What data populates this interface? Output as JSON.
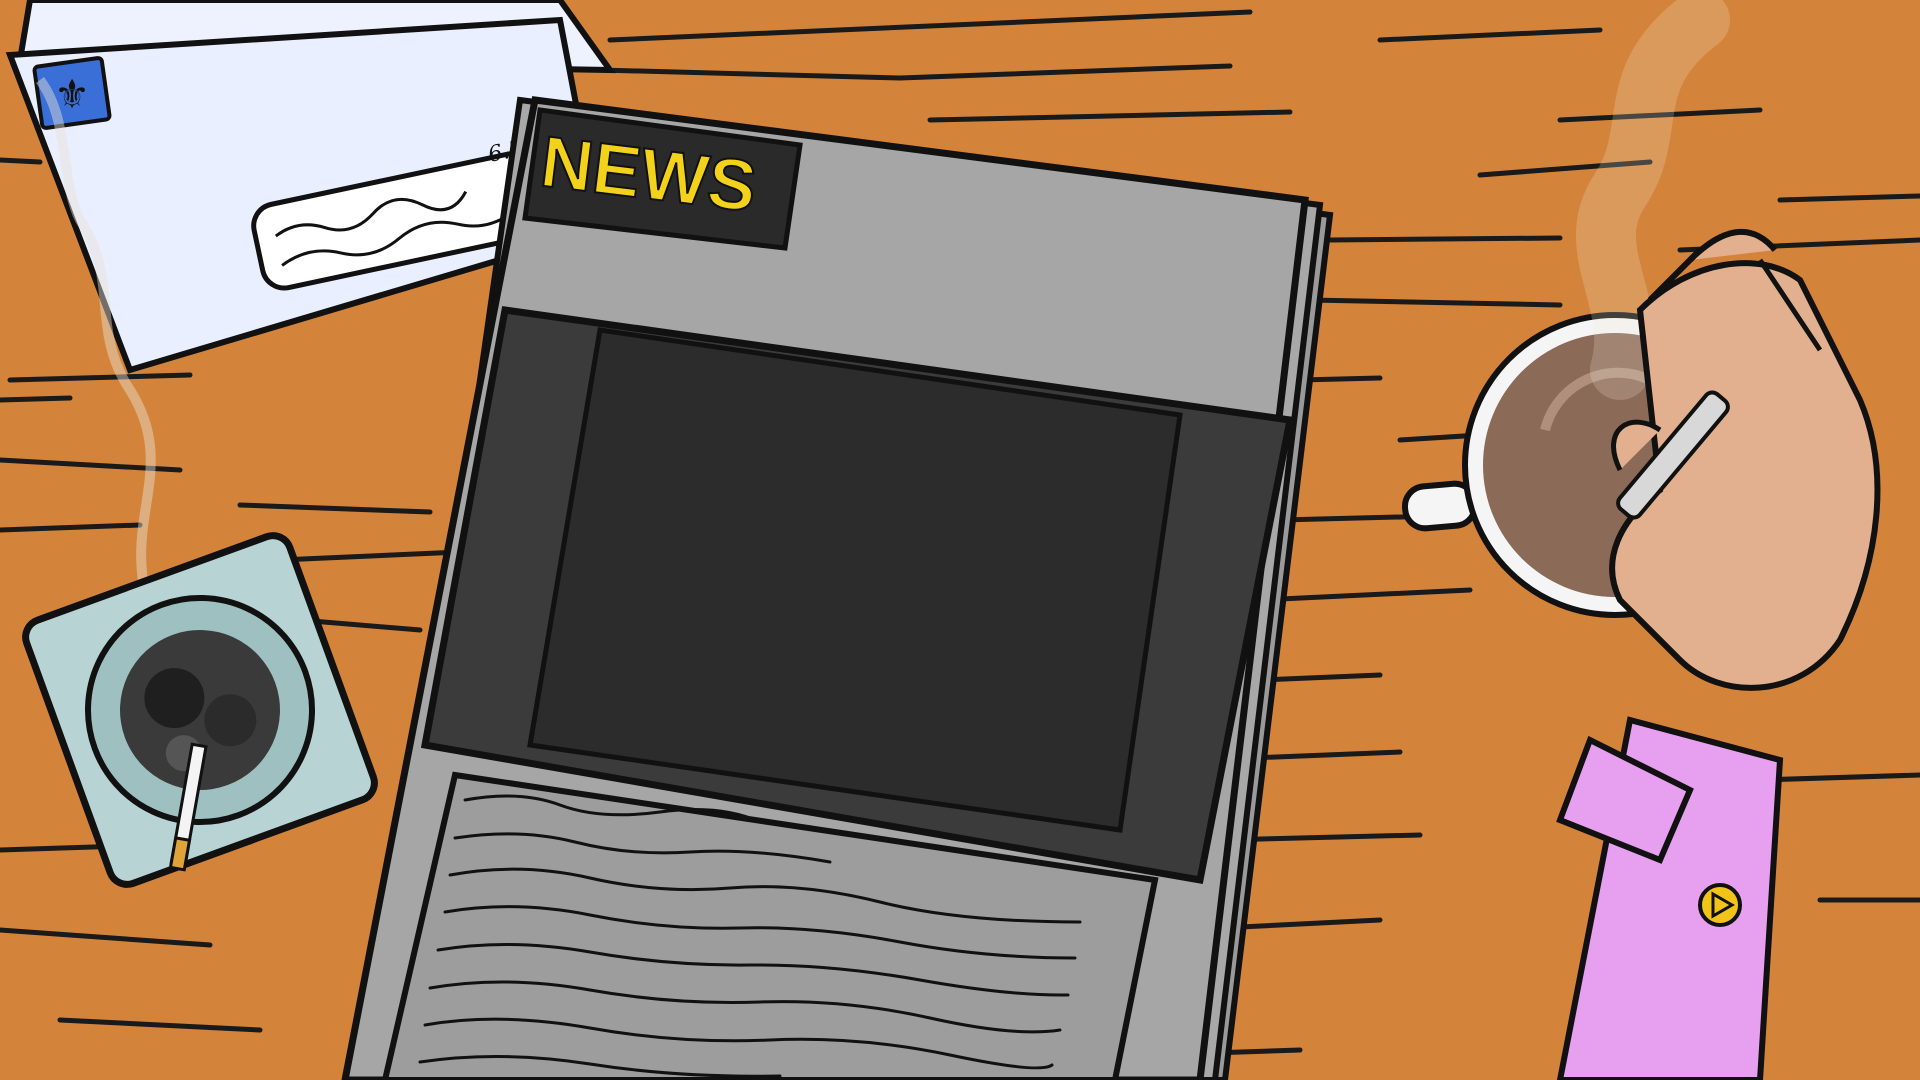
{
  "scene": {
    "description_free": true,
    "colors": {
      "desk": "#d4843a",
      "desk_grain": "#1a1a1a",
      "paper_light": "#a9a9a9",
      "paper_dark": "#3a3a3a",
      "news_yellow": "#f2d21b",
      "envelope": "#e9efff",
      "stamp": "#3b6fd8",
      "coffee": "#8b6a57",
      "skin": "#e2b08e",
      "sleeve": "#e6a0ef",
      "cufflink": "#f2c419",
      "ashtray": "#b7d3d3"
    }
  },
  "newspaper": {
    "masthead": "NEWS"
  },
  "envelope": {
    "date": "6.7.3"
  },
  "icons": {
    "stamp": "fleur-de-lis-icon",
    "cufflink": "play-triangle-icon"
  }
}
